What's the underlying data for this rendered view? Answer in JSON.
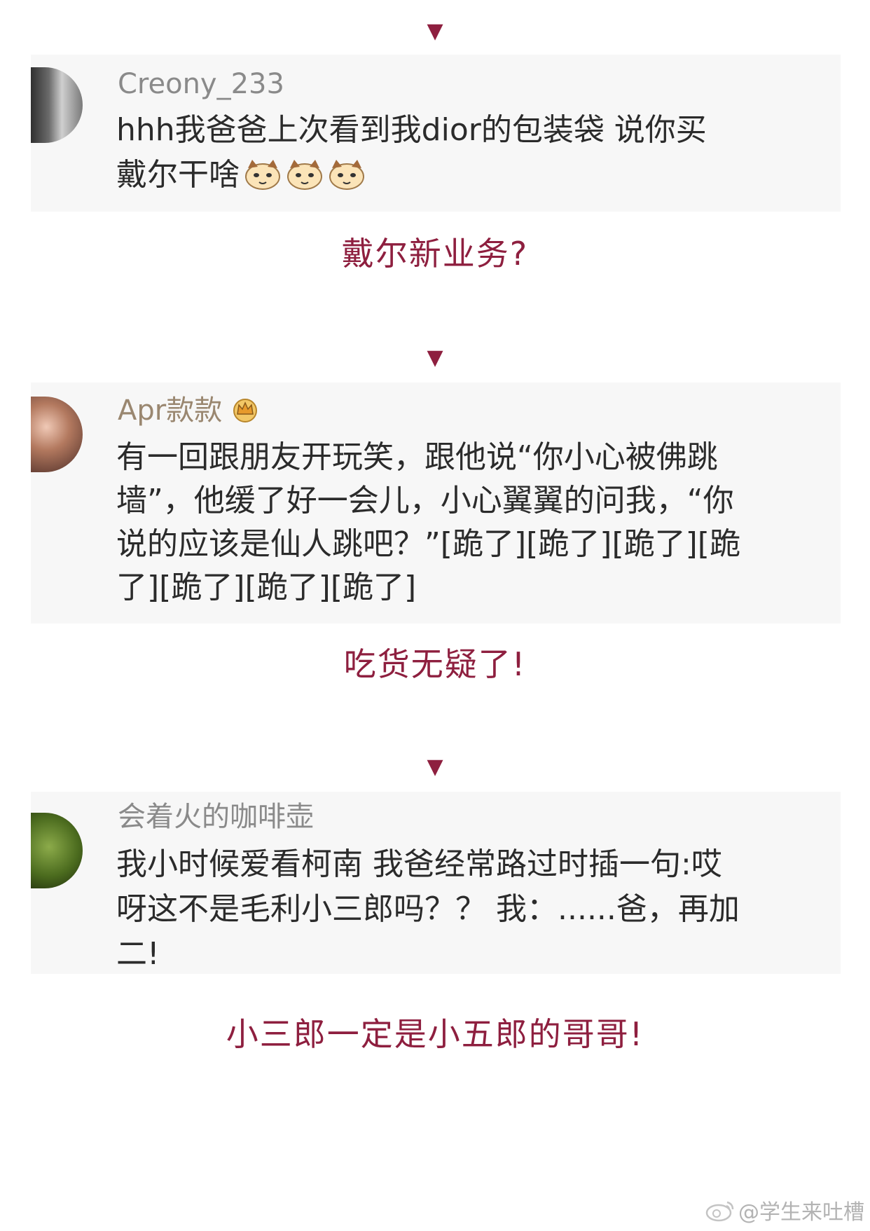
{
  "posts": [
    {
      "username": "Creony_233",
      "text": "hhh我爸爸上次看到我dior的包装袋 说你买戴尔干啥",
      "emoji": [
        "cat-face-icon",
        "cat-face-icon",
        "cat-face-icon"
      ],
      "caption": "戴尔新业务?"
    },
    {
      "username": "Apr款款",
      "badge": "crown-icon",
      "text": "有一回跟朋友开玩笑，跟他说“你小心被佛跳墙”，他缓了好一会儿，小心翼翼的问我，“你说的应该是仙人跳吧？”[跪了][跪了][跪了][跪了][跪了][跪了][跪了]",
      "caption": "吃货无疑了!"
    },
    {
      "username": "会着火的咖啡壶",
      "text": "我小时候爱看柯南 我爸经常路过时插一句:哎呀这不是毛利小三郎吗？？ 我：......爸，再加二!",
      "caption": "小三郎一定是小五郎的哥哥!"
    }
  ],
  "arrow_glyph": "▼",
  "watermark": "@学生来吐槽",
  "colors": {
    "accent": "#8e1f3f",
    "card_bg": "#f7f7f7",
    "username": "#8a8a8a",
    "text": "#2b2b2b"
  }
}
